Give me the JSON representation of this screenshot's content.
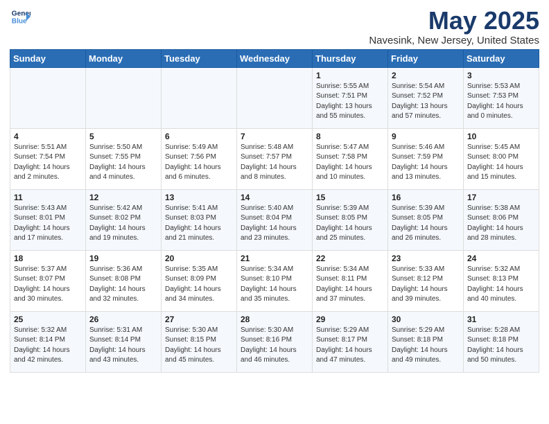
{
  "header": {
    "logo_line1": "General",
    "logo_line2": "Blue",
    "title": "May 2025",
    "subtitle": "Navesink, New Jersey, United States"
  },
  "weekdays": [
    "Sunday",
    "Monday",
    "Tuesday",
    "Wednesday",
    "Thursday",
    "Friday",
    "Saturday"
  ],
  "weeks": [
    [
      {
        "day": "",
        "info": ""
      },
      {
        "day": "",
        "info": ""
      },
      {
        "day": "",
        "info": ""
      },
      {
        "day": "",
        "info": ""
      },
      {
        "day": "1",
        "info": "Sunrise: 5:55 AM\nSunset: 7:51 PM\nDaylight: 13 hours\nand 55 minutes."
      },
      {
        "day": "2",
        "info": "Sunrise: 5:54 AM\nSunset: 7:52 PM\nDaylight: 13 hours\nand 57 minutes."
      },
      {
        "day": "3",
        "info": "Sunrise: 5:53 AM\nSunset: 7:53 PM\nDaylight: 14 hours\nand 0 minutes."
      }
    ],
    [
      {
        "day": "4",
        "info": "Sunrise: 5:51 AM\nSunset: 7:54 PM\nDaylight: 14 hours\nand 2 minutes."
      },
      {
        "day": "5",
        "info": "Sunrise: 5:50 AM\nSunset: 7:55 PM\nDaylight: 14 hours\nand 4 minutes."
      },
      {
        "day": "6",
        "info": "Sunrise: 5:49 AM\nSunset: 7:56 PM\nDaylight: 14 hours\nand 6 minutes."
      },
      {
        "day": "7",
        "info": "Sunrise: 5:48 AM\nSunset: 7:57 PM\nDaylight: 14 hours\nand 8 minutes."
      },
      {
        "day": "8",
        "info": "Sunrise: 5:47 AM\nSunset: 7:58 PM\nDaylight: 14 hours\nand 10 minutes."
      },
      {
        "day": "9",
        "info": "Sunrise: 5:46 AM\nSunset: 7:59 PM\nDaylight: 14 hours\nand 13 minutes."
      },
      {
        "day": "10",
        "info": "Sunrise: 5:45 AM\nSunset: 8:00 PM\nDaylight: 14 hours\nand 15 minutes."
      }
    ],
    [
      {
        "day": "11",
        "info": "Sunrise: 5:43 AM\nSunset: 8:01 PM\nDaylight: 14 hours\nand 17 minutes."
      },
      {
        "day": "12",
        "info": "Sunrise: 5:42 AM\nSunset: 8:02 PM\nDaylight: 14 hours\nand 19 minutes."
      },
      {
        "day": "13",
        "info": "Sunrise: 5:41 AM\nSunset: 8:03 PM\nDaylight: 14 hours\nand 21 minutes."
      },
      {
        "day": "14",
        "info": "Sunrise: 5:40 AM\nSunset: 8:04 PM\nDaylight: 14 hours\nand 23 minutes."
      },
      {
        "day": "15",
        "info": "Sunrise: 5:39 AM\nSunset: 8:05 PM\nDaylight: 14 hours\nand 25 minutes."
      },
      {
        "day": "16",
        "info": "Sunrise: 5:39 AM\nSunset: 8:05 PM\nDaylight: 14 hours\nand 26 minutes."
      },
      {
        "day": "17",
        "info": "Sunrise: 5:38 AM\nSunset: 8:06 PM\nDaylight: 14 hours\nand 28 minutes."
      }
    ],
    [
      {
        "day": "18",
        "info": "Sunrise: 5:37 AM\nSunset: 8:07 PM\nDaylight: 14 hours\nand 30 minutes."
      },
      {
        "day": "19",
        "info": "Sunrise: 5:36 AM\nSunset: 8:08 PM\nDaylight: 14 hours\nand 32 minutes."
      },
      {
        "day": "20",
        "info": "Sunrise: 5:35 AM\nSunset: 8:09 PM\nDaylight: 14 hours\nand 34 minutes."
      },
      {
        "day": "21",
        "info": "Sunrise: 5:34 AM\nSunset: 8:10 PM\nDaylight: 14 hours\nand 35 minutes."
      },
      {
        "day": "22",
        "info": "Sunrise: 5:34 AM\nSunset: 8:11 PM\nDaylight: 14 hours\nand 37 minutes."
      },
      {
        "day": "23",
        "info": "Sunrise: 5:33 AM\nSunset: 8:12 PM\nDaylight: 14 hours\nand 39 minutes."
      },
      {
        "day": "24",
        "info": "Sunrise: 5:32 AM\nSunset: 8:13 PM\nDaylight: 14 hours\nand 40 minutes."
      }
    ],
    [
      {
        "day": "25",
        "info": "Sunrise: 5:32 AM\nSunset: 8:14 PM\nDaylight: 14 hours\nand 42 minutes."
      },
      {
        "day": "26",
        "info": "Sunrise: 5:31 AM\nSunset: 8:14 PM\nDaylight: 14 hours\nand 43 minutes."
      },
      {
        "day": "27",
        "info": "Sunrise: 5:30 AM\nSunset: 8:15 PM\nDaylight: 14 hours\nand 45 minutes."
      },
      {
        "day": "28",
        "info": "Sunrise: 5:30 AM\nSunset: 8:16 PM\nDaylight: 14 hours\nand 46 minutes."
      },
      {
        "day": "29",
        "info": "Sunrise: 5:29 AM\nSunset: 8:17 PM\nDaylight: 14 hours\nand 47 minutes."
      },
      {
        "day": "30",
        "info": "Sunrise: 5:29 AM\nSunset: 8:18 PM\nDaylight: 14 hours\nand 49 minutes."
      },
      {
        "day": "31",
        "info": "Sunrise: 5:28 AM\nSunset: 8:18 PM\nDaylight: 14 hours\nand 50 minutes."
      }
    ]
  ]
}
